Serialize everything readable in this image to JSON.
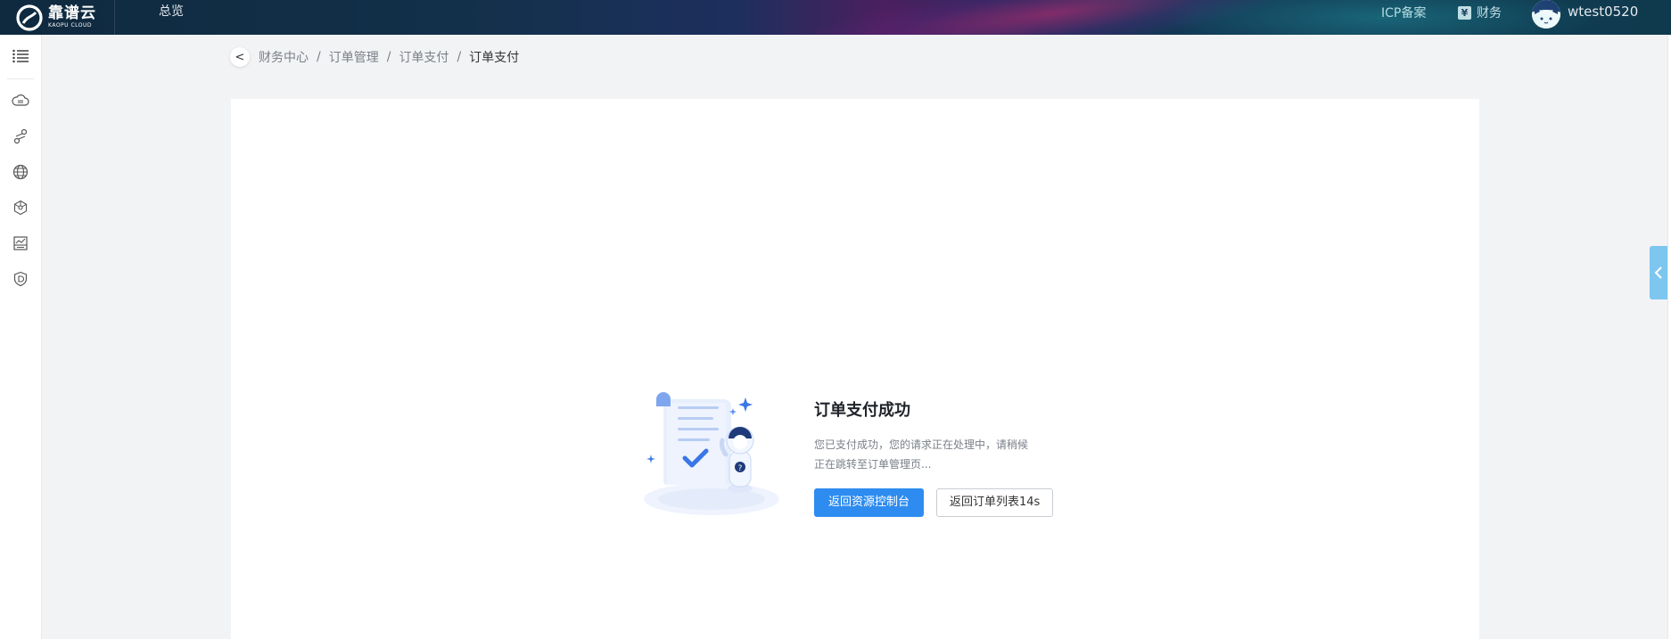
{
  "header": {
    "logo_cn": "靠谱云",
    "logo_en": "KAOPU CLOUD",
    "nav_overview": "总览",
    "icp": "ICP备案",
    "finance_icon_glyph": "¥",
    "finance": "财务",
    "username": "wtest0520"
  },
  "sidebar": {
    "items": [
      {
        "icon": "menu-list-icon"
      },
      {
        "icon": "cloud-server-icon"
      },
      {
        "icon": "network-link-icon"
      },
      {
        "icon": "globe-icon"
      },
      {
        "icon": "hexagon-network-icon"
      },
      {
        "icon": "storage-icon"
      },
      {
        "icon": "shield-icon"
      }
    ]
  },
  "breadcrumb": {
    "back_glyph": "<",
    "items": [
      "财务中心",
      "订单管理",
      "订单支付",
      "订单支付"
    ],
    "separator": "/"
  },
  "result": {
    "title": "订单支付成功",
    "desc_line1": "您已支付成功，您的请求正在处理中，请稍候",
    "desc_line2": "正在跳转至订单管理页...",
    "primary_button": "返回资源控制台",
    "secondary_button": "返回订单列表14s"
  },
  "colors": {
    "primary": "#2e8cf0",
    "side_tab": "#7cc6f0"
  }
}
